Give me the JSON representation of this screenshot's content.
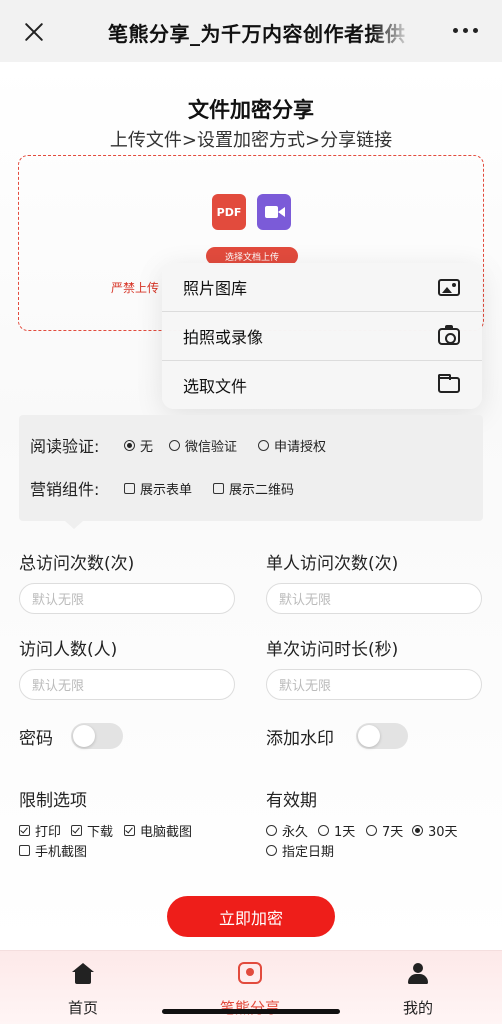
{
  "topbar": {
    "title": "笔熊分享_为千万内容创作者提供"
  },
  "hero": {
    "title": "文件加密分享",
    "subtitle": "上传文件>设置加密方式>分享链接"
  },
  "upload": {
    "pdf_label": "PDF",
    "button_label": "选择文档上传",
    "warning": "严禁上传"
  },
  "picker_menu": {
    "items": [
      {
        "label": "照片图库",
        "icon": "photos-icon"
      },
      {
        "label": "拍照或录像",
        "icon": "camera-icon"
      },
      {
        "label": "选取文件",
        "icon": "folder-icon"
      }
    ]
  },
  "settings": {
    "read_verify_label": "阅读验证:",
    "read_verify_options": [
      {
        "label": "无",
        "selected": true
      },
      {
        "label": "微信验证",
        "selected": false
      },
      {
        "label": "申请授权",
        "selected": false
      }
    ],
    "marketing_label": "营销组件:",
    "marketing_options": [
      {
        "label": "展示表单",
        "checked": false
      },
      {
        "label": "展示二维码",
        "checked": false
      }
    ]
  },
  "fields": {
    "total_visits": {
      "label": "总访问次数(次)",
      "placeholder": "默认无限"
    },
    "per_user_visits": {
      "label": "单人访问次数(次)",
      "placeholder": "默认无限"
    },
    "visitor_count": {
      "label": "访问人数(人)",
      "placeholder": "默认无限"
    },
    "per_visit_duration": {
      "label": "单次访问时长(秒)",
      "placeholder": "默认无限"
    },
    "password": {
      "label": "密码",
      "enabled": false
    },
    "watermark": {
      "label": "添加水印",
      "enabled": false
    }
  },
  "restrictions": {
    "label": "限制选项",
    "options": [
      {
        "label": "打印",
        "checked": true
      },
      {
        "label": "下载",
        "checked": true
      },
      {
        "label": "电脑截图",
        "checked": true
      },
      {
        "label": "手机截图",
        "checked": false
      }
    ]
  },
  "validity": {
    "label": "有效期",
    "options": [
      {
        "label": "永久",
        "selected": false
      },
      {
        "label": "1天",
        "selected": false
      },
      {
        "label": "7天",
        "selected": false
      },
      {
        "label": "30天",
        "selected": true
      },
      {
        "label": "指定日期",
        "selected": false
      }
    ]
  },
  "submit_label": "立即加密",
  "tabbar": {
    "items": [
      {
        "label": "首页",
        "icon": "home-icon",
        "active": false
      },
      {
        "label": "笔熊分享",
        "icon": "share-icon",
        "active": true
      },
      {
        "label": "我的",
        "icon": "user-icon",
        "active": false
      }
    ]
  },
  "colors": {
    "accent": "#e24b3d",
    "button": "#ee1e1a"
  }
}
